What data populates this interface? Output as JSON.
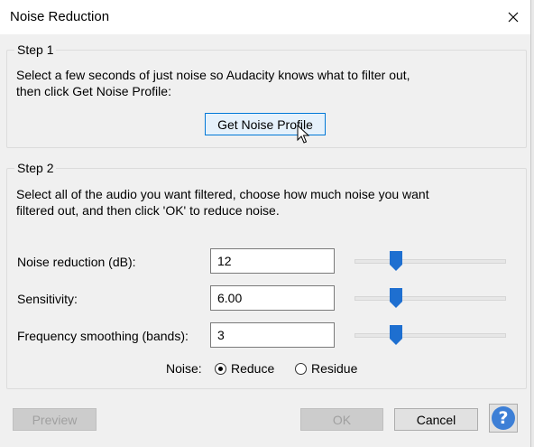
{
  "window": {
    "title": "Noise Reduction",
    "close_icon": "close-icon"
  },
  "step1": {
    "legend": "Step 1",
    "description": "Select a few seconds of just noise so Audacity knows what to filter out,\nthen click Get Noise Profile:",
    "get_profile_button": "Get Noise Profile"
  },
  "step2": {
    "legend": "Step 2",
    "description": "Select all of the audio you want filtered, choose how much noise you want\nfiltered out, and then click 'OK' to reduce noise.",
    "fields": [
      {
        "label": "Noise reduction (dB):",
        "value": "12",
        "slider_fraction": 0.25
      },
      {
        "label": "Sensitivity:",
        "value": "6.00",
        "slider_fraction": 0.25
      },
      {
        "label": "Frequency smoothing (bands):",
        "value": "3",
        "slider_fraction": 0.25
      }
    ],
    "noise_label": "Noise:",
    "noise_options": [
      {
        "label": "Reduce",
        "checked": true
      },
      {
        "label": "Residue",
        "checked": false
      }
    ]
  },
  "buttons": {
    "preview": "Preview",
    "ok": "OK",
    "cancel": "Cancel",
    "help_glyph": "?",
    "help_icon": "help-icon"
  },
  "colors": {
    "accent": "#0078d7",
    "slider_thumb": "#1e6fd0",
    "help": "#3d7fd6"
  }
}
